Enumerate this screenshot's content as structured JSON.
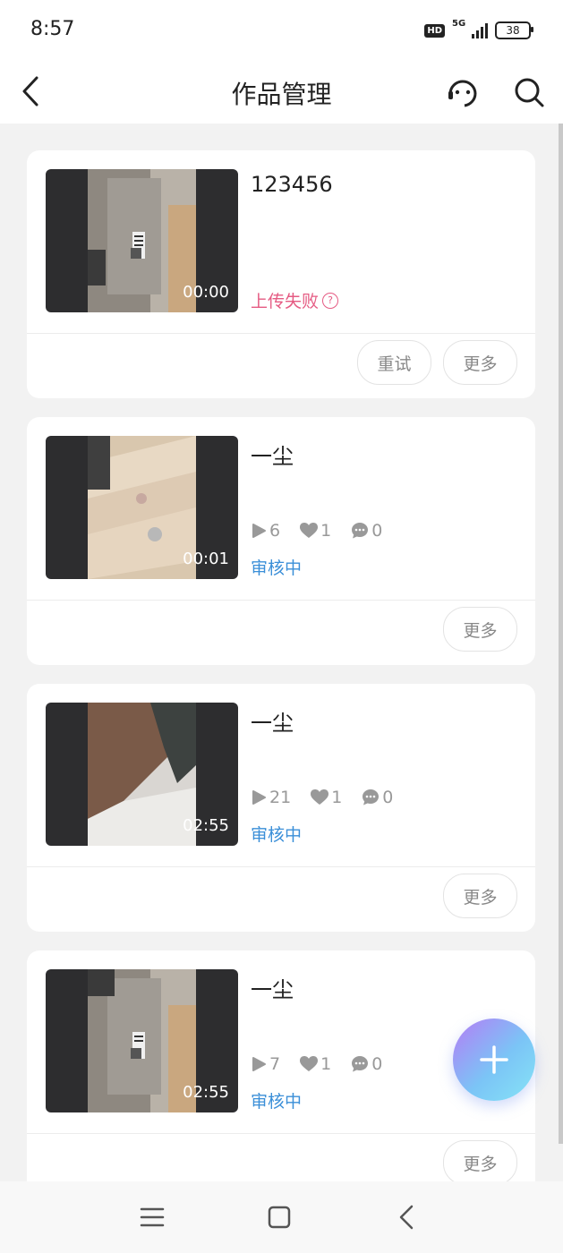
{
  "status_bar": {
    "time": "8:57",
    "hd": "HD",
    "network": "5G",
    "battery": "38"
  },
  "header": {
    "title": "作品管理"
  },
  "works": [
    {
      "title": "123456",
      "duration": "00:00",
      "status": "上传失败",
      "help": "?",
      "retry_label": "重试",
      "more_label": "更多"
    },
    {
      "title": "一尘",
      "duration": "00:01",
      "plays": "6",
      "likes": "1",
      "comments": "0",
      "status": "审核中",
      "more_label": "更多"
    },
    {
      "title": "一尘",
      "duration": "02:55",
      "plays": "21",
      "likes": "1",
      "comments": "0",
      "status": "审核中",
      "more_label": "更多"
    },
    {
      "title": "一尘",
      "duration": "02:55",
      "plays": "7",
      "likes": "1",
      "comments": "0",
      "status": "审核中",
      "more_label": "更多"
    }
  ],
  "colors": {
    "fail": "#e55b83",
    "review": "#3b8fd8",
    "fab_start": "#b57cf5",
    "fab_end": "#86e4f6"
  },
  "icons": [
    "back-arrow-icon",
    "customer-service-icon",
    "search-icon",
    "question-icon",
    "play-icon",
    "heart-icon",
    "comment-icon",
    "plus-icon",
    "menu-icon",
    "home-square-icon",
    "nav-back-icon"
  ]
}
